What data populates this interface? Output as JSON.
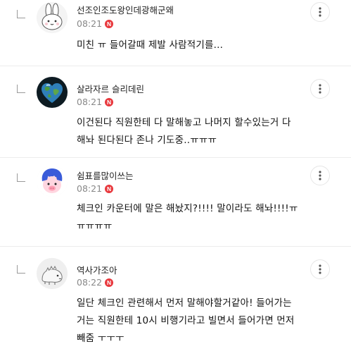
{
  "comments": [
    {
      "nickname": "선조인조도왕인데광해군왜",
      "time": "08:21",
      "badge": "N",
      "text": "미친 ㅠ 들어갈때 제발 사람적기를...",
      "avatar": "bunny-avatar"
    },
    {
      "nickname": "살라자르 슬리데린",
      "time": "08:21",
      "badge": "N",
      "text": "이건된다 직원한테 다 말해놓고 나머지 할수있는거 다\n해놔 된다된다 존나 기도중..ㅠㅠㅠ",
      "avatar": "earth-heart-avatar"
    },
    {
      "nickname": "쉼표를많이쓰는",
      "time": "08:21",
      "badge": "N",
      "text": "체크인 카운터에 말은 해놨지?!!!! 말이라도 해놔!!!!ㅠ\nㅠㅠㅠㅠ",
      "avatar": "blue-hair-character-avatar"
    },
    {
      "nickname": "역사가조아",
      "time": "08:22",
      "badge": "N",
      "text": "일단 체크인 관련해서 먼저 말해야할거같아! 들어가는\n거는 직원한테 10시 비행기라고 빌면서 들어가면 먼저\n빼줌 ㅜㅜㅜ",
      "avatar": "dinosaur-avatar"
    }
  ],
  "colors": {
    "new_badge": "#e8383d",
    "time_text": "#888888",
    "divider": "#ececec"
  }
}
